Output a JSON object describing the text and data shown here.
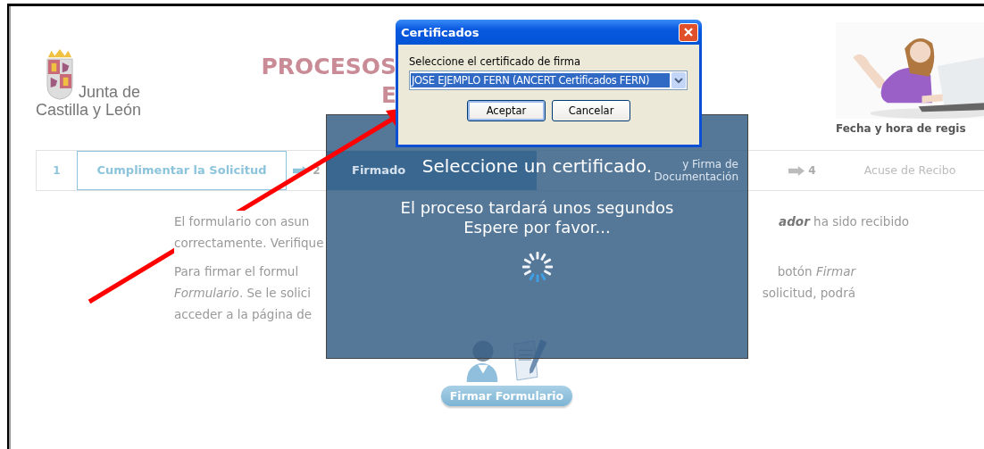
{
  "header": {
    "logo_lines": [
      "Junta de",
      "Castilla y León"
    ],
    "title_lines": [
      "PROCESOS",
      "E"
    ],
    "registration_label": "Fecha y hora de regis"
  },
  "steps": [
    {
      "number": "1",
      "label": "Cumplimentar la Solicitud",
      "kind": "link",
      "selected": false
    },
    {
      "number": "2",
      "label": "Firmado",
      "kind": "plain",
      "selected": true
    },
    {
      "label": "y Firma de Documentación",
      "kind": "plain",
      "selected": false
    },
    {
      "number": "4",
      "label": "Acuse de Recibo",
      "kind": "plain",
      "selected": false
    }
  ],
  "paragraphs": [
    {
      "lines": [
        {
          "left": "El formulario con asun",
          "right": "**ador** ha sido recibido"
        },
        {
          "left": "correctamente. Verifique"
        }
      ]
    },
    {
      "lines": [
        {
          "left": "Para firmar el formul",
          "right": "botón *Firmar*"
        },
        {
          "left": "*Formulario*. Se le solici",
          "right": "solicitud, podrá"
        },
        {
          "left": "acceder a la página de"
        }
      ]
    }
  ],
  "sign_button": "Firmar Formulario",
  "overlay": {
    "title": "Seleccione un certificado.",
    "message_lines": [
      "El proceso tardará unos segundos",
      "Espere por favor..."
    ]
  },
  "dialog": {
    "title": "Certificados",
    "label": "Seleccione el certificado de firma",
    "certificate": "JOSE EJEMPLO FERN (ANCERT Certificados FERN)",
    "buttons": [
      {
        "label": "Aceptar",
        "default": true
      },
      {
        "label": "Cancelar",
        "default": false
      }
    ]
  }
}
